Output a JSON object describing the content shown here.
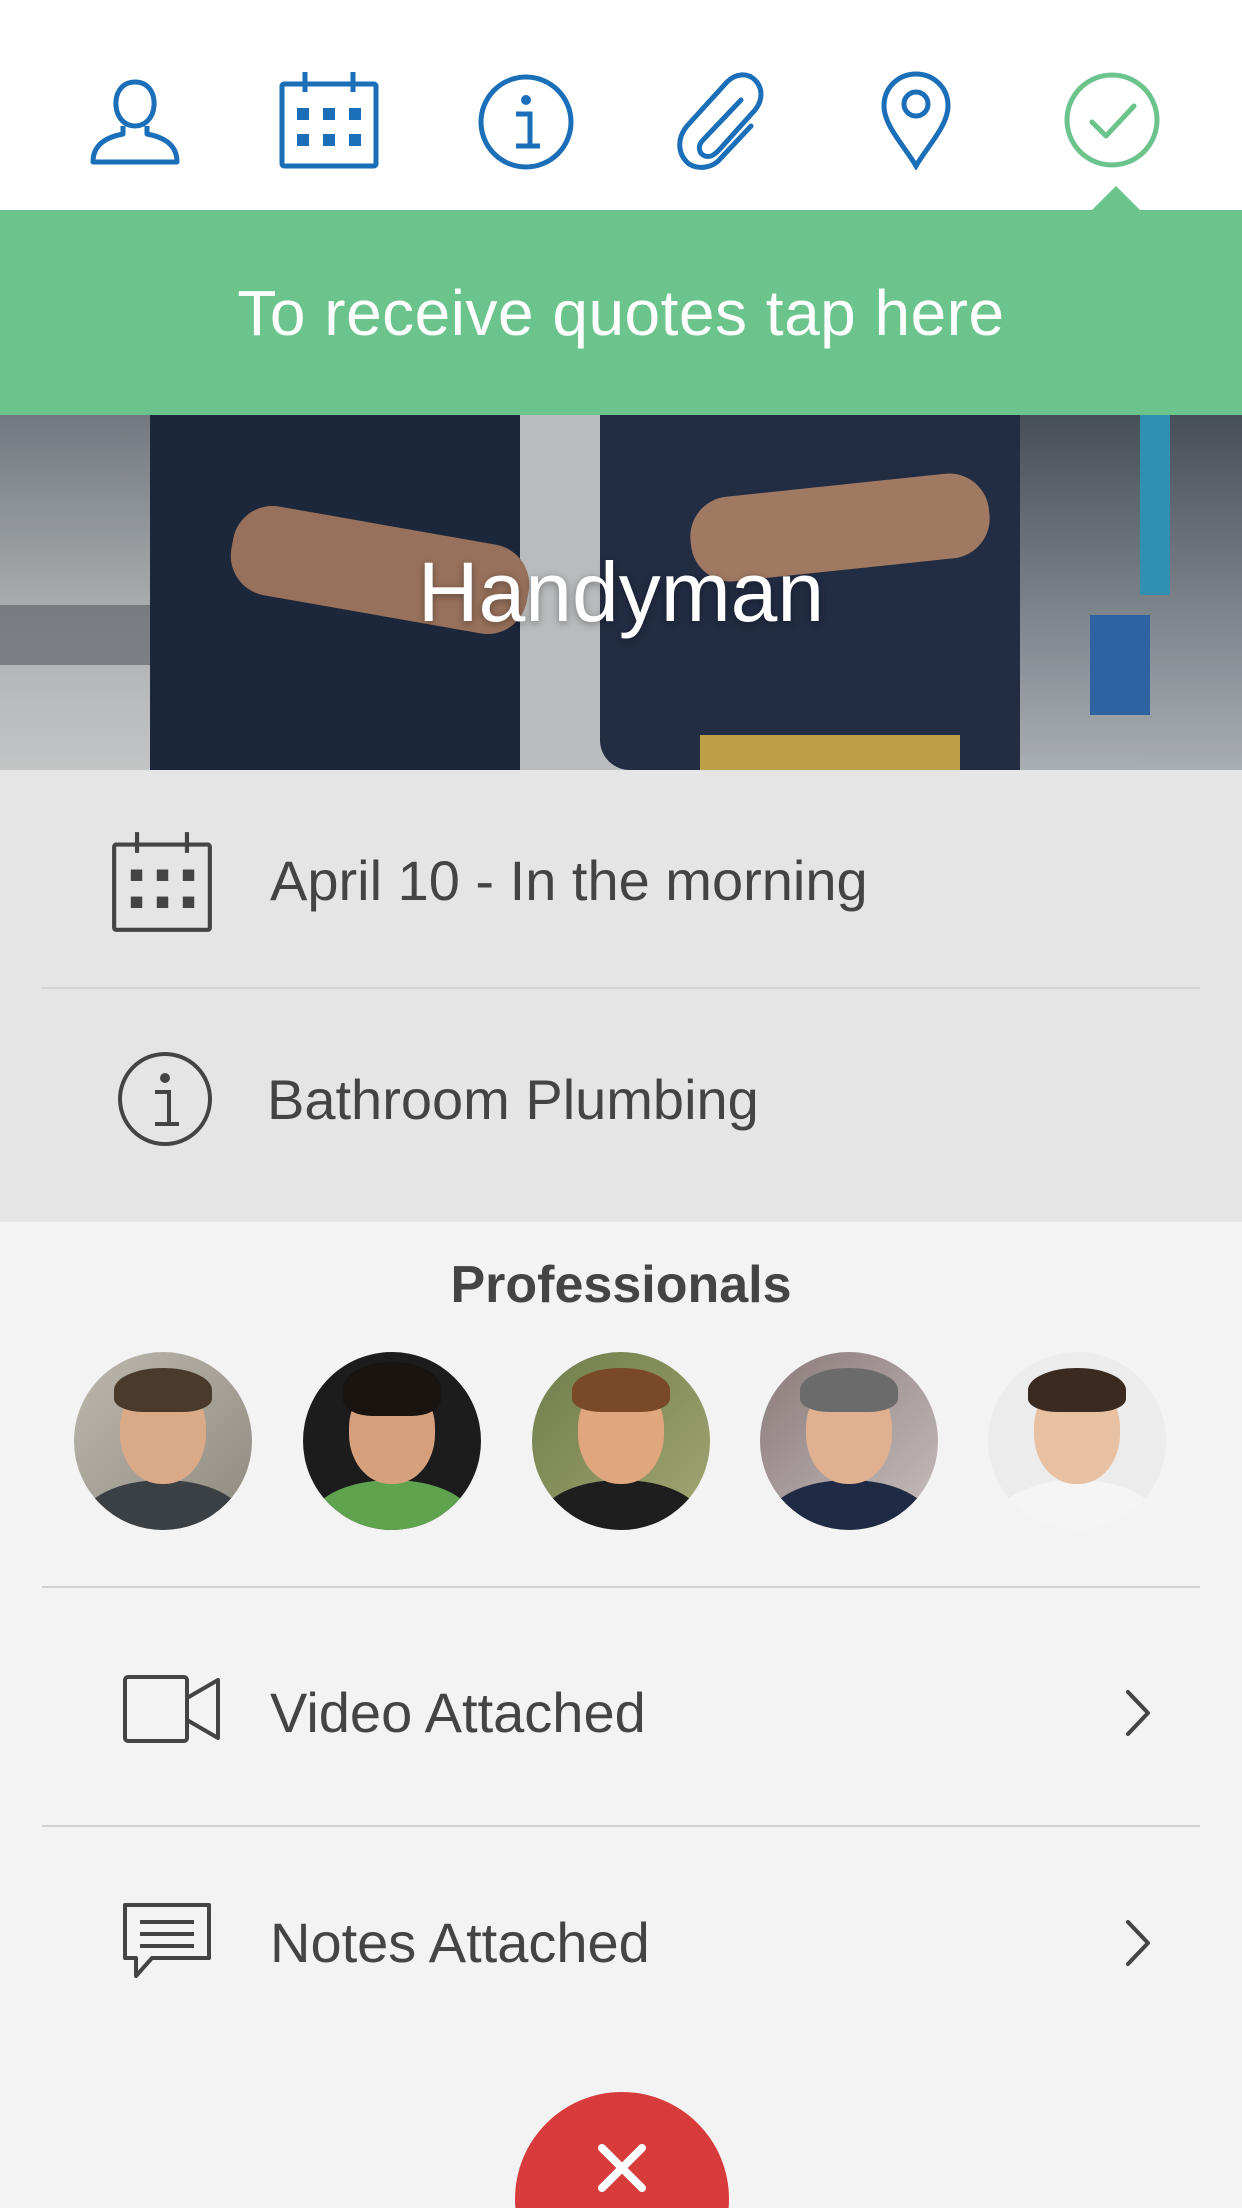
{
  "steps": [
    {
      "name": "profile",
      "icon": "user-icon"
    },
    {
      "name": "date",
      "icon": "calendar-icon"
    },
    {
      "name": "info",
      "icon": "info-icon"
    },
    {
      "name": "attachments",
      "icon": "paperclip-icon"
    },
    {
      "name": "location",
      "icon": "map-pin-icon"
    },
    {
      "name": "confirm",
      "icon": "check-circle-icon"
    }
  ],
  "banner": {
    "text": "To receive quotes tap here"
  },
  "hero": {
    "title": "Handyman"
  },
  "details": {
    "date": {
      "text": "April 10 - In the morning",
      "icon": "calendar-icon"
    },
    "description": {
      "text": "Bathroom Plumbing",
      "icon": "info-icon"
    }
  },
  "professionals": {
    "title": "Professionals",
    "count": 5
  },
  "attachments": [
    {
      "label": "Video Attached",
      "icon": "video-camera-icon"
    },
    {
      "label": "Notes Attached",
      "icon": "chat-bubble-icon"
    }
  ],
  "fab": {
    "icon": "close-icon"
  },
  "colors": {
    "accent_blue": "#1a6fb8",
    "accent_green": "#6ac48b",
    "danger_red": "#d83b3b"
  }
}
